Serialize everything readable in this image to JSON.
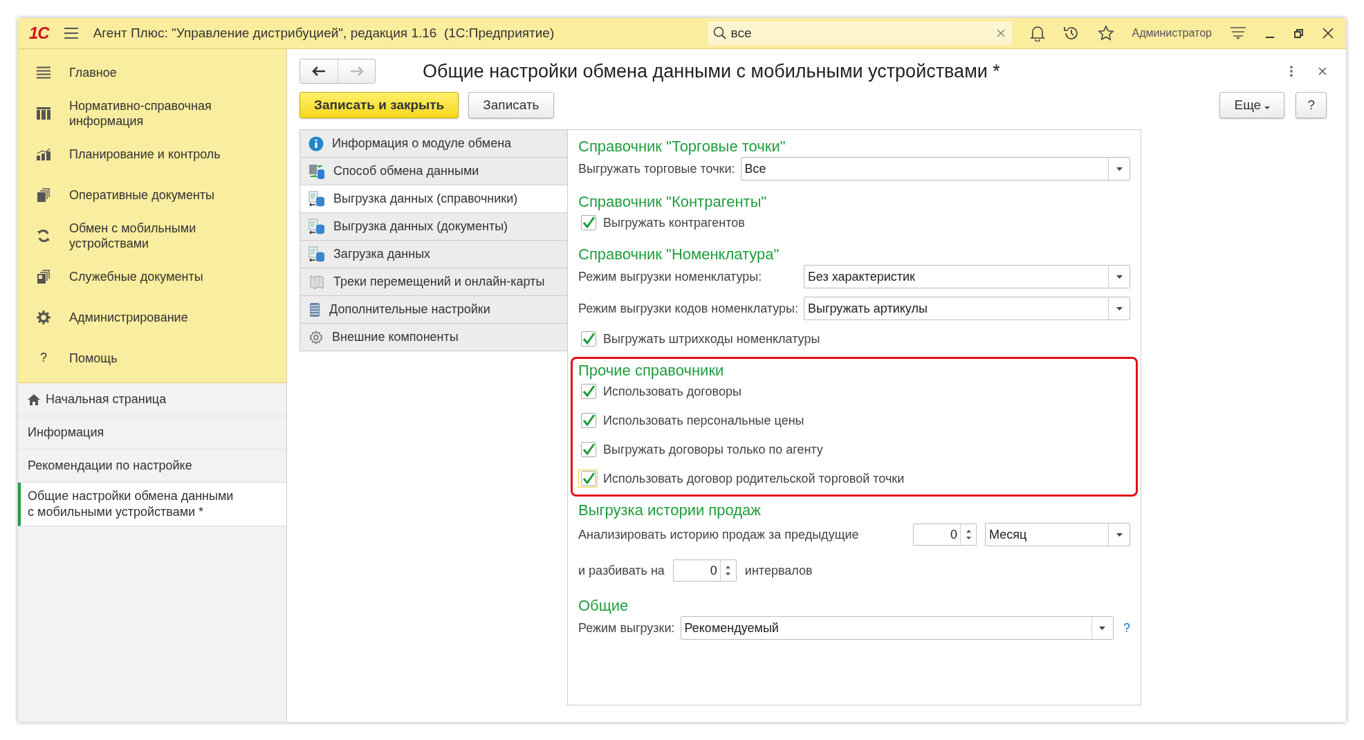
{
  "app": {
    "logo": "1С",
    "title": "Агент Плюс: \"Управление дистрибуцией\", редакция 1.16  (1С:Предприятие)",
    "search": "все",
    "user": "Администратор"
  },
  "menu": [
    {
      "label": "Главное",
      "kind": "list"
    },
    {
      "label": "Нормативно-справочная информация",
      "kind": "grid"
    },
    {
      "label": "Планирование и контроль",
      "kind": "chart"
    },
    {
      "label": "Оперативные документы",
      "kind": "docs"
    },
    {
      "label": "Обмен с мобильными устройствами",
      "kind": "sync"
    },
    {
      "label": "Служебные документы",
      "kind": "service"
    },
    {
      "label": "Администрирование",
      "kind": "gear"
    },
    {
      "label": "Помощь",
      "kind": "help",
      "glyph": "?"
    }
  ],
  "windows": [
    {
      "label": "Начальная страница",
      "kind": "home",
      "selected": false
    },
    {
      "label": "Информация",
      "kind": "plain",
      "selected": false
    },
    {
      "label": "Рекомендации по настройке",
      "kind": "plain",
      "selected": false
    },
    {
      "label": "Общие настройки обмена данными с мобильными устройствами *",
      "kind": "plain",
      "selected": true
    }
  ],
  "form": {
    "title": "Общие настройки обмена данными с мобильными устройствами *",
    "back_enabled": true,
    "forward_enabled": false,
    "buttons": [
      {
        "label": "Записать и закрыть",
        "kind": "primary"
      },
      {
        "label": "Записать",
        "kind": "normal"
      }
    ],
    "more": "Еще",
    "help": "?"
  },
  "tabs": [
    {
      "label": "Информация о модуле обмена",
      "kind": "info",
      "selected": false
    },
    {
      "label": "Способ обмена данными",
      "kind": "exchange",
      "selected": false
    },
    {
      "label": "Выгрузка данных (справочники)",
      "kind": "upload",
      "selected": true
    },
    {
      "label": "Выгрузка данных (документы)",
      "kind": "upload",
      "selected": false
    },
    {
      "label": "Загрузка данных",
      "kind": "upload",
      "selected": false
    },
    {
      "label": "Треки перемещений и онлайн-карты",
      "kind": "map",
      "selected": false
    },
    {
      "label": "Дополнительные настройки",
      "kind": "stack",
      "selected": false
    },
    {
      "label": "Внешние компоненты",
      "kind": "gear",
      "selected": false
    }
  ],
  "sections": [
    {
      "heading": "Справочник \"Торговые точки\"",
      "highlighted": false,
      "rows": [
        {
          "kind": "select",
          "label": "Выгружать торговые точки:",
          "value": "Все"
        }
      ]
    },
    {
      "heading": "Справочник \"Контрагенты\"",
      "highlighted": false,
      "rows": [
        {
          "kind": "checkbox",
          "label": "Выгружать контрагентов",
          "checked": true,
          "focused": false
        }
      ]
    },
    {
      "heading": "Справочник \"Номенклатура\"",
      "highlighted": false,
      "rows": [
        {
          "kind": "select",
          "label": "Режим выгрузки номенклатуры:",
          "value": "Без характеристик"
        },
        {
          "kind": "select",
          "label": "Режим выгрузки кодов номенклатуры:",
          "value": "Выгружать артикулы"
        },
        {
          "kind": "checkbox",
          "label": "Выгружать штрихкоды номенклатуры",
          "checked": true,
          "focused": false
        }
      ]
    },
    {
      "heading": "Прочие справочники",
      "highlighted": true,
      "rows": [
        {
          "kind": "checkbox",
          "label": "Использовать договоры",
          "checked": true,
          "focused": false
        },
        {
          "kind": "checkbox",
          "label": "Использовать персональные цены",
          "checked": true,
          "focused": false
        },
        {
          "kind": "checkbox",
          "label": "Выгружать договоры только по агенту",
          "checked": true,
          "focused": false
        },
        {
          "kind": "checkbox",
          "label": "Использовать договор родительской торговой точки",
          "checked": true,
          "focused": true
        }
      ]
    },
    {
      "heading": "Выгрузка истории продаж",
      "highlighted": false,
      "rows": [
        {
          "kind": "period",
          "label": "Анализировать историю продаж за предыдущие",
          "number": "0",
          "value": "Месяц"
        },
        {
          "kind": "intervals",
          "label": "и разбивать на",
          "number": "0",
          "suffix": "интервалов"
        }
      ]
    },
    {
      "heading": "Общие",
      "highlighted": false,
      "rows": [
        {
          "kind": "select-help",
          "label": "Режим выгрузки:",
          "value": "Рекомендуемый",
          "help": "?"
        }
      ]
    }
  ]
}
